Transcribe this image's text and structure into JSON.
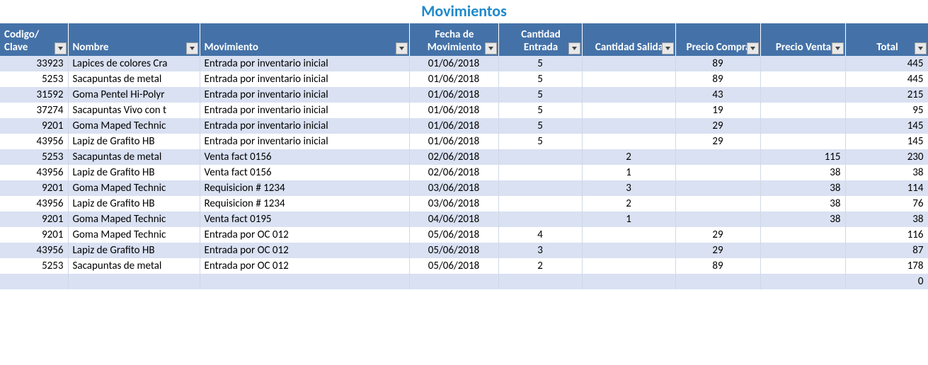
{
  "title": "Movimientos",
  "headers": {
    "codigo": "Codigo/\nClave",
    "nombre": "Nombre",
    "movimiento": "Movimiento",
    "fecha": "Fecha de Movimiento",
    "cent": "Cantidad Entrada",
    "csal": "Cantidad Salida",
    "pcom": "Precio Compra",
    "pven": "Precio Venta",
    "total": "Total"
  },
  "rows": [
    {
      "codigo": "33923",
      "nombre": "Lapices de colores Cra",
      "mov": "Entrada por inventario inicial",
      "fecha": "01/06/2018",
      "cent": "5",
      "csal": "",
      "pcom": "89",
      "pven": "",
      "total": "445"
    },
    {
      "codigo": "5253",
      "nombre": "Sacapuntas de metal",
      "mov": "Entrada por inventario inicial",
      "fecha": "01/06/2018",
      "cent": "5",
      "csal": "",
      "pcom": "89",
      "pven": "",
      "total": "445"
    },
    {
      "codigo": "31592",
      "nombre": "Goma Pentel Hi-Polyr",
      "mov": "Entrada por inventario inicial",
      "fecha": "01/06/2018",
      "cent": "5",
      "csal": "",
      "pcom": "43",
      "pven": "",
      "total": "215"
    },
    {
      "codigo": "37274",
      "nombre": "Sacapuntas Vivo con t",
      "mov": "Entrada por inventario inicial",
      "fecha": "01/06/2018",
      "cent": "5",
      "csal": "",
      "pcom": "19",
      "pven": "",
      "total": "95"
    },
    {
      "codigo": "9201",
      "nombre": "Goma Maped Technic",
      "mov": "Entrada por inventario inicial",
      "fecha": "01/06/2018",
      "cent": "5",
      "csal": "",
      "pcom": "29",
      "pven": "",
      "total": "145"
    },
    {
      "codigo": "43956",
      "nombre": "Lapiz de Grafito HB",
      "mov": "Entrada por inventario inicial",
      "fecha": "01/06/2018",
      "cent": "5",
      "csal": "",
      "pcom": "29",
      "pven": "",
      "total": "145"
    },
    {
      "codigo": "5253",
      "nombre": "Sacapuntas de metal",
      "mov": "Venta fact 0156",
      "fecha": "02/06/2018",
      "cent": "",
      "csal": "2",
      "pcom": "",
      "pven": "115",
      "total": "230"
    },
    {
      "codigo": "43956",
      "nombre": "Lapiz de Grafito HB",
      "mov": "Venta fact 0156",
      "fecha": "02/06/2018",
      "cent": "",
      "csal": "1",
      "pcom": "",
      "pven": "38",
      "total": "38"
    },
    {
      "codigo": "9201",
      "nombre": "Goma Maped Technic",
      "mov": "Requisicion # 1234",
      "fecha": "03/06/2018",
      "cent": "",
      "csal": "3",
      "pcom": "",
      "pven": "38",
      "total": "114"
    },
    {
      "codigo": "43956",
      "nombre": "Lapiz de Grafito HB",
      "mov": "Requisicion # 1234",
      "fecha": "03/06/2018",
      "cent": "",
      "csal": "2",
      "pcom": "",
      "pven": "38",
      "total": "76"
    },
    {
      "codigo": "9201",
      "nombre": "Goma Maped Technic",
      "mov": "Venta fact 0195",
      "fecha": "04/06/2018",
      "cent": "",
      "csal": "1",
      "pcom": "",
      "pven": "38",
      "total": "38"
    },
    {
      "codigo": "9201",
      "nombre": "Goma Maped Technic",
      "mov": "Entrada por OC 012",
      "fecha": "05/06/2018",
      "cent": "4",
      "csal": "",
      "pcom": "29",
      "pven": "",
      "total": "116"
    },
    {
      "codigo": "43956",
      "nombre": "Lapiz de Grafito HB",
      "mov": "Entrada por OC 012",
      "fecha": "05/06/2018",
      "cent": "3",
      "csal": "",
      "pcom": "29",
      "pven": "",
      "total": "87"
    },
    {
      "codigo": "5253",
      "nombre": "Sacapuntas de metal",
      "mov": "Entrada por OC 012",
      "fecha": "05/06/2018",
      "cent": "2",
      "csal": "",
      "pcom": "89",
      "pven": "",
      "total": "178"
    }
  ],
  "totals_total": "0"
}
